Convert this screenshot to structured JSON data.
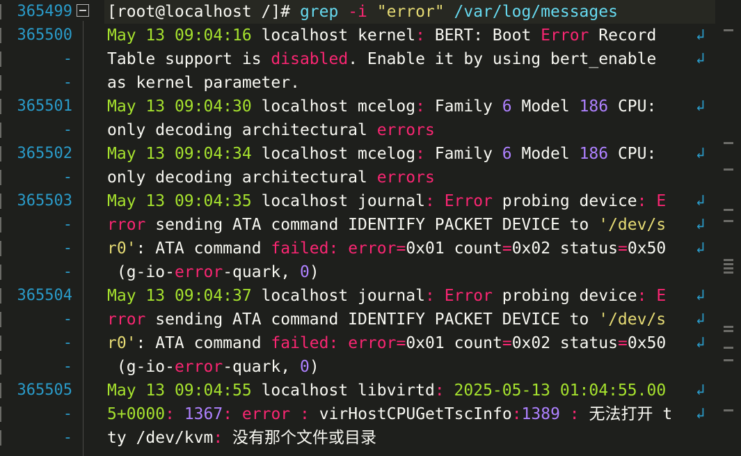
{
  "gutter": {
    "fold_marker": "⊟",
    "wrap_icon": "↲",
    "lines": [
      "365499",
      "365500",
      "-",
      "-",
      "365501",
      "-",
      "365502",
      "-",
      "365503",
      "-",
      "-",
      "-",
      "365504",
      "-",
      "-",
      "-",
      "365505",
      "-",
      "-"
    ]
  },
  "code": {
    "lines": [
      [
        {
          "t": "[root@localhost /]#",
          "c": "t-ok"
        },
        {
          "t": " grep ",
          "c": "t-kw"
        },
        {
          "t": "-i ",
          "c": "t-op"
        },
        {
          "t": "\"error\"",
          "c": "t-str"
        },
        {
          "t": " /var/log/messages",
          "c": "t-kw"
        }
      ],
      [
        {
          "t": "May 13 ",
          "c": "t-date"
        },
        {
          "t": "09:04:16",
          "c": "t-date"
        },
        {
          "t": " localhost kernel",
          "c": "t-ok"
        },
        {
          "t": ":",
          "c": "t-op"
        },
        {
          "t": " BERT: Boot ",
          "c": "t-ok"
        },
        {
          "t": "Error",
          "c": "t-err"
        },
        {
          "t": " Record ",
          "c": "t-ok"
        }
      ],
      [
        {
          "t": "Table support is ",
          "c": "t-ok"
        },
        {
          "t": "disabled",
          "c": "t-err"
        },
        {
          "t": ". Enable it by using bert_enable ",
          "c": "t-ok"
        }
      ],
      [
        {
          "t": "as kernel parameter.",
          "c": "t-ok"
        }
      ],
      [
        {
          "t": "May 13 ",
          "c": "t-date"
        },
        {
          "t": "09:04:30",
          "c": "t-date"
        },
        {
          "t": " localhost mcelog",
          "c": "t-ok"
        },
        {
          "t": ":",
          "c": "t-op"
        },
        {
          "t": " Family ",
          "c": "t-ok"
        },
        {
          "t": "6",
          "c": "t-num"
        },
        {
          "t": " Model ",
          "c": "t-ok"
        },
        {
          "t": "186",
          "c": "t-num"
        },
        {
          "t": " CPU: ",
          "c": "t-ok"
        }
      ],
      [
        {
          "t": "only decoding architectural ",
          "c": "t-ok"
        },
        {
          "t": "errors",
          "c": "t-err"
        }
      ],
      [
        {
          "t": "May 13 ",
          "c": "t-date"
        },
        {
          "t": "09:04:34",
          "c": "t-date"
        },
        {
          "t": " localhost mcelog",
          "c": "t-ok"
        },
        {
          "t": ":",
          "c": "t-op"
        },
        {
          "t": " Family ",
          "c": "t-ok"
        },
        {
          "t": "6",
          "c": "t-num"
        },
        {
          "t": " Model ",
          "c": "t-ok"
        },
        {
          "t": "186",
          "c": "t-num"
        },
        {
          "t": " CPU: ",
          "c": "t-ok"
        }
      ],
      [
        {
          "t": "only decoding architectural ",
          "c": "t-ok"
        },
        {
          "t": "errors",
          "c": "t-err"
        }
      ],
      [
        {
          "t": "May 13 ",
          "c": "t-date"
        },
        {
          "t": "09:04:35",
          "c": "t-date"
        },
        {
          "t": " localhost journal",
          "c": "t-ok"
        },
        {
          "t": ":",
          "c": "t-op"
        },
        {
          "t": " ",
          "c": "t-ok"
        },
        {
          "t": "Error",
          "c": "t-err"
        },
        {
          "t": " probing device",
          "c": "t-ok"
        },
        {
          "t": ":",
          "c": "t-op"
        },
        {
          "t": " ",
          "c": "t-ok"
        },
        {
          "t": "E",
          "c": "t-err"
        }
      ],
      [
        {
          "t": "rror",
          "c": "t-err"
        },
        {
          "t": " sending ATA command IDENTIFY PACKET DEVICE to ",
          "c": "t-ok"
        },
        {
          "t": "'/dev/s",
          "c": "t-str"
        }
      ],
      [
        {
          "t": "r0'",
          "c": "t-str"
        },
        {
          "t": ": ATA command ",
          "c": "t-ok"
        },
        {
          "t": "failed",
          "c": "t-err"
        },
        {
          "t": ":",
          "c": "t-op"
        },
        {
          "t": " ",
          "c": "t-ok"
        },
        {
          "t": "error",
          "c": "t-err"
        },
        {
          "t": "=",
          "c": "t-op"
        },
        {
          "t": "0x01 count",
          "c": "t-ok"
        },
        {
          "t": "=",
          "c": "t-op"
        },
        {
          "t": "0x02 status",
          "c": "t-ok"
        },
        {
          "t": "=",
          "c": "t-op"
        },
        {
          "t": "0x50",
          "c": "t-ok"
        }
      ],
      [
        {
          "t": " (g-io-",
          "c": "t-ok"
        },
        {
          "t": "error",
          "c": "t-err"
        },
        {
          "t": "-quark, ",
          "c": "t-ok"
        },
        {
          "t": "0",
          "c": "t-num"
        },
        {
          "t": ")",
          "c": "t-ok"
        }
      ],
      [
        {
          "t": "May 13 ",
          "c": "t-date"
        },
        {
          "t": "09:04:37",
          "c": "t-date"
        },
        {
          "t": " localhost journal",
          "c": "t-ok"
        },
        {
          "t": ":",
          "c": "t-op"
        },
        {
          "t": " ",
          "c": "t-ok"
        },
        {
          "t": "Error",
          "c": "t-err"
        },
        {
          "t": " probing device",
          "c": "t-ok"
        },
        {
          "t": ":",
          "c": "t-op"
        },
        {
          "t": " ",
          "c": "t-ok"
        },
        {
          "t": "E",
          "c": "t-err"
        }
      ],
      [
        {
          "t": "rror",
          "c": "t-err"
        },
        {
          "t": " sending ATA command IDENTIFY PACKET DEVICE to ",
          "c": "t-ok"
        },
        {
          "t": "'/dev/s",
          "c": "t-str"
        }
      ],
      [
        {
          "t": "r0'",
          "c": "t-str"
        },
        {
          "t": ": ATA command ",
          "c": "t-ok"
        },
        {
          "t": "failed",
          "c": "t-err"
        },
        {
          "t": ":",
          "c": "t-op"
        },
        {
          "t": " ",
          "c": "t-ok"
        },
        {
          "t": "error",
          "c": "t-err"
        },
        {
          "t": "=",
          "c": "t-op"
        },
        {
          "t": "0x01 count",
          "c": "t-ok"
        },
        {
          "t": "=",
          "c": "t-op"
        },
        {
          "t": "0x02 status",
          "c": "t-ok"
        },
        {
          "t": "=",
          "c": "t-op"
        },
        {
          "t": "0x50",
          "c": "t-ok"
        }
      ],
      [
        {
          "t": " (g-io-",
          "c": "t-ok"
        },
        {
          "t": "error",
          "c": "t-err"
        },
        {
          "t": "-quark, ",
          "c": "t-ok"
        },
        {
          "t": "0",
          "c": "t-num"
        },
        {
          "t": ")",
          "c": "t-ok"
        }
      ],
      [
        {
          "t": "May 13 ",
          "c": "t-date"
        },
        {
          "t": "09:04:55",
          "c": "t-date"
        },
        {
          "t": " localhost libvirtd",
          "c": "t-ok"
        },
        {
          "t": ":",
          "c": "t-op"
        },
        {
          "t": " ",
          "c": "t-ok"
        },
        {
          "t": "2025-05-13 01:04:55.00",
          "c": "t-date"
        }
      ],
      [
        {
          "t": "5+0000",
          "c": "t-date"
        },
        {
          "t": ":",
          "c": "t-op"
        },
        {
          "t": " ",
          "c": "t-ok"
        },
        {
          "t": "1367",
          "c": "t-num"
        },
        {
          "t": ":",
          "c": "t-op"
        },
        {
          "t": " ",
          "c": "t-ok"
        },
        {
          "t": "error",
          "c": "t-err"
        },
        {
          "t": " ",
          "c": "t-ok"
        },
        {
          "t": ":",
          "c": "t-op"
        },
        {
          "t": " virHostCPUGetTscInfo",
          "c": "t-ok"
        },
        {
          "t": ":",
          "c": "t-op"
        },
        {
          "t": "1389",
          "c": "t-num"
        },
        {
          "t": " ",
          "c": "t-ok"
        },
        {
          "t": ":",
          "c": "t-op"
        },
        {
          "t": " 无法打开 t",
          "c": "t-ok"
        }
      ],
      [
        {
          "t": "ty /dev/kvm",
          "c": "t-ok"
        },
        {
          "t": ":",
          "c": "t-op"
        },
        {
          "t": " 没有那个文件或目录",
          "c": "t-ok"
        }
      ]
    ],
    "wrapped_rows": [
      1,
      2,
      4,
      6,
      8,
      9,
      10,
      12,
      13,
      14,
      16,
      17
    ]
  },
  "colors": {
    "background": "#1e1f1c",
    "gutter_text": "#2a9bc9",
    "keyword": "#66d9ef",
    "date": "#a6e22e",
    "number": "#ae81ff",
    "error": "#f92672",
    "string": "#e6db74"
  }
}
